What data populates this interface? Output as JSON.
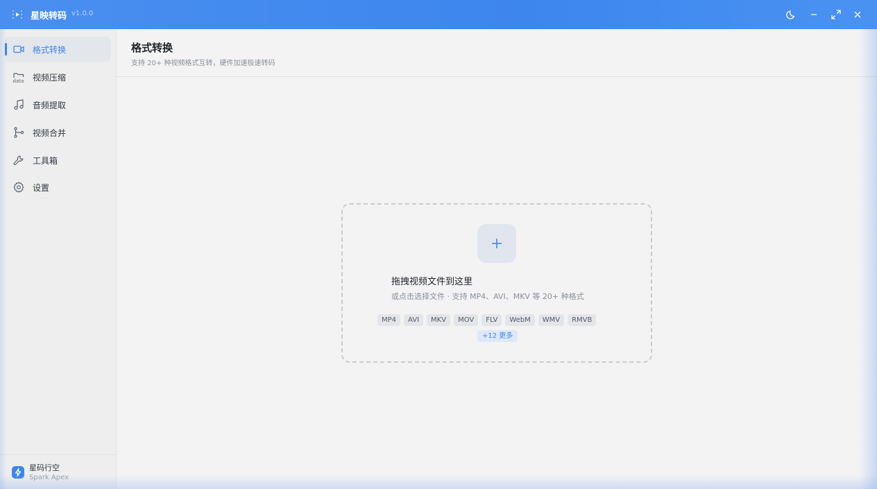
{
  "app": {
    "name": "星映转码",
    "version": "v1.0.0",
    "icon": "app-video-icon",
    "accent_color": "#3d86ee"
  },
  "window_controls": [
    {
      "name": "theme-toggle",
      "icon": "moon-icon"
    },
    {
      "name": "minimize",
      "icon": "minimize-icon"
    },
    {
      "name": "maximize",
      "icon": "maximize-icon"
    },
    {
      "name": "close",
      "icon": "close-icon"
    }
  ],
  "sidebar": {
    "items": [
      {
        "label": "格式转换",
        "icon": "video-camera-icon",
        "active": true
      },
      {
        "label": "视频压缩",
        "icon": "data-folder-icon",
        "active": false
      },
      {
        "label": "音频提取",
        "icon": "music-note-icon",
        "active": false
      },
      {
        "label": "视频合并",
        "icon": "merge-branch-icon",
        "active": false
      },
      {
        "label": "工具箱",
        "icon": "wrench-icon",
        "active": false
      },
      {
        "label": "设置",
        "icon": "gear-icon",
        "active": false
      }
    ],
    "footer": {
      "title": "星码行空",
      "subtitle": "Spark Apex",
      "icon": "lightning-icon"
    }
  },
  "main": {
    "title": "格式转换",
    "subtitle": "支持 20+ 种视频格式互转，硬件加速极速转码",
    "dropzone": {
      "icon": "plus-icon",
      "title": "拖拽视频文件到这里",
      "hint": "或点击选择文件 · 支持 MP4、AVI、MKV 等 20+ 种格式",
      "formats": [
        "MP4",
        "AVI",
        "MKV",
        "MOV",
        "FLV",
        "WebM",
        "WMV",
        "RMVB"
      ],
      "more": "+12 更多"
    }
  }
}
